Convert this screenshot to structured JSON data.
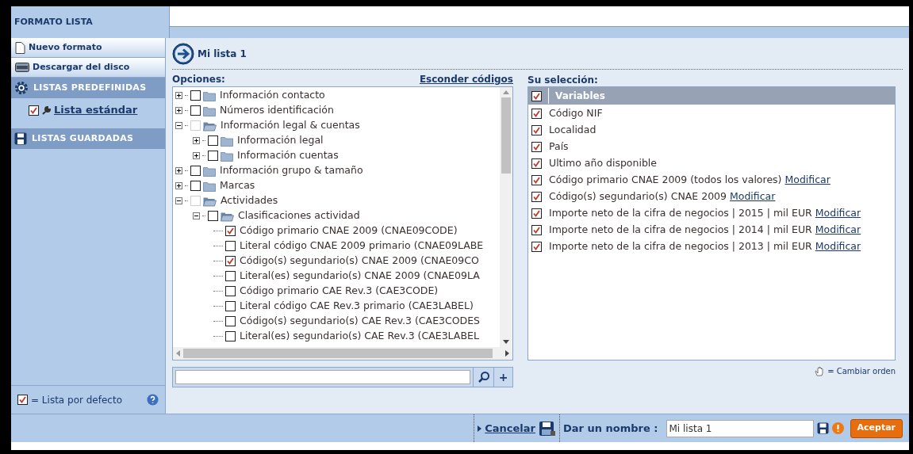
{
  "header": {
    "title": "FORMATO LISTA"
  },
  "sidebar": {
    "items": [
      {
        "kind": "button",
        "label": "Nuevo formato"
      },
      {
        "kind": "button",
        "label": "Descargar del disco"
      },
      {
        "kind": "section",
        "label": "LISTAS PREDEFINIDAS",
        "children": [
          {
            "label": "Lista estándar",
            "checked": true
          }
        ]
      },
      {
        "kind": "section",
        "label": "LISTAS GUARDADAS"
      }
    ],
    "legend": {
      "checked": true,
      "label": "= Lista por defecto"
    }
  },
  "list_title": "Mi lista 1",
  "options": {
    "label": "Opciones:",
    "toggle_link": "Esconder códigos",
    "tree": [
      {
        "kind": "folder",
        "label": "Información contacto",
        "expanded": false,
        "checked": false,
        "dimmed": false
      },
      {
        "kind": "folder",
        "label": "Números identificación",
        "expanded": false,
        "checked": false,
        "dimmed": false
      },
      {
        "kind": "folder",
        "label": "Información legal & cuentas",
        "expanded": true,
        "checked": false,
        "dimmed": true,
        "children": [
          {
            "kind": "folder",
            "label": "Información legal",
            "expanded": false,
            "checked": false,
            "dimmed": false
          },
          {
            "kind": "folder",
            "label": "Información cuentas",
            "expanded": false,
            "checked": false,
            "dimmed": false
          }
        ]
      },
      {
        "kind": "folder",
        "label": "Información grupo & tamaño",
        "expanded": false,
        "checked": false,
        "dimmed": false
      },
      {
        "kind": "folder",
        "label": "Marcas",
        "expanded": false,
        "checked": false,
        "dimmed": false
      },
      {
        "kind": "folder",
        "label": "Actividades",
        "expanded": true,
        "checked": false,
        "dimmed": true,
        "children": [
          {
            "kind": "folder",
            "label": "Clasificaciones actividad",
            "expanded": true,
            "checked": false,
            "dimmed": false,
            "children": [
              {
                "kind": "field",
                "label": "Código primario CNAE 2009 (CNAE09CODE)",
                "checked": true
              },
              {
                "kind": "field",
                "label": "Literal código CNAE 2009 primario (CNAE09LABE",
                "checked": false
              },
              {
                "kind": "field",
                "label": "Código(s) segundario(s) CNAE 2009 (CNAE09CO",
                "checked": true
              },
              {
                "kind": "field",
                "label": "Literal(es) segundario(s) CNAE 2009 (CNAE09LA",
                "checked": false
              },
              {
                "kind": "field",
                "label": "Código primario CAE Rev.3 (CAE3CODE)",
                "checked": false
              },
              {
                "kind": "field",
                "label": "Literal código CAE Rev.3 primario (CAE3LABEL)",
                "checked": false
              },
              {
                "kind": "field",
                "label": "Código(s) segundario(s) CAE Rev.3 (CAE3CODES",
                "checked": false
              },
              {
                "kind": "field",
                "label": "Literal(es) segundario(s) CAE Rev.3 (CAE3LABEL",
                "checked": false
              }
            ]
          }
        ]
      }
    ],
    "search": {
      "add": "+"
    }
  },
  "selection": {
    "label": "Su selección:",
    "header": {
      "label": "Variables",
      "checked": true
    },
    "rows": [
      {
        "label": "Código NIF",
        "checked": true
      },
      {
        "label": "Localidad",
        "checked": true
      },
      {
        "label": "País",
        "checked": true
      },
      {
        "label": "Ultimo año disponible",
        "checked": true
      },
      {
        "label": "Código primario CNAE 2009 (todos los valores)",
        "checked": true,
        "link": "Modificar"
      },
      {
        "label": "Código(s) segundario(s) CNAE 2009",
        "checked": true,
        "link": "Modificar"
      },
      {
        "label": "Importe neto de la cifra de negocios | 2015 | mil EUR",
        "checked": true,
        "link": "Modificar"
      },
      {
        "label": "Importe neto de la cifra de negocios | 2014 | mil EUR",
        "checked": true,
        "link": "Modificar"
      },
      {
        "label": "Importe neto de la cifra de negocios | 2013 | mil EUR",
        "checked": true,
        "link": "Modificar"
      }
    ],
    "reorder_hint": "= Cambiar orden"
  },
  "footer": {
    "cancel": "Cancelar",
    "name_label": "Dar un nombre :",
    "name_value": "Mi lista 1",
    "accept": "Aceptar"
  }
}
